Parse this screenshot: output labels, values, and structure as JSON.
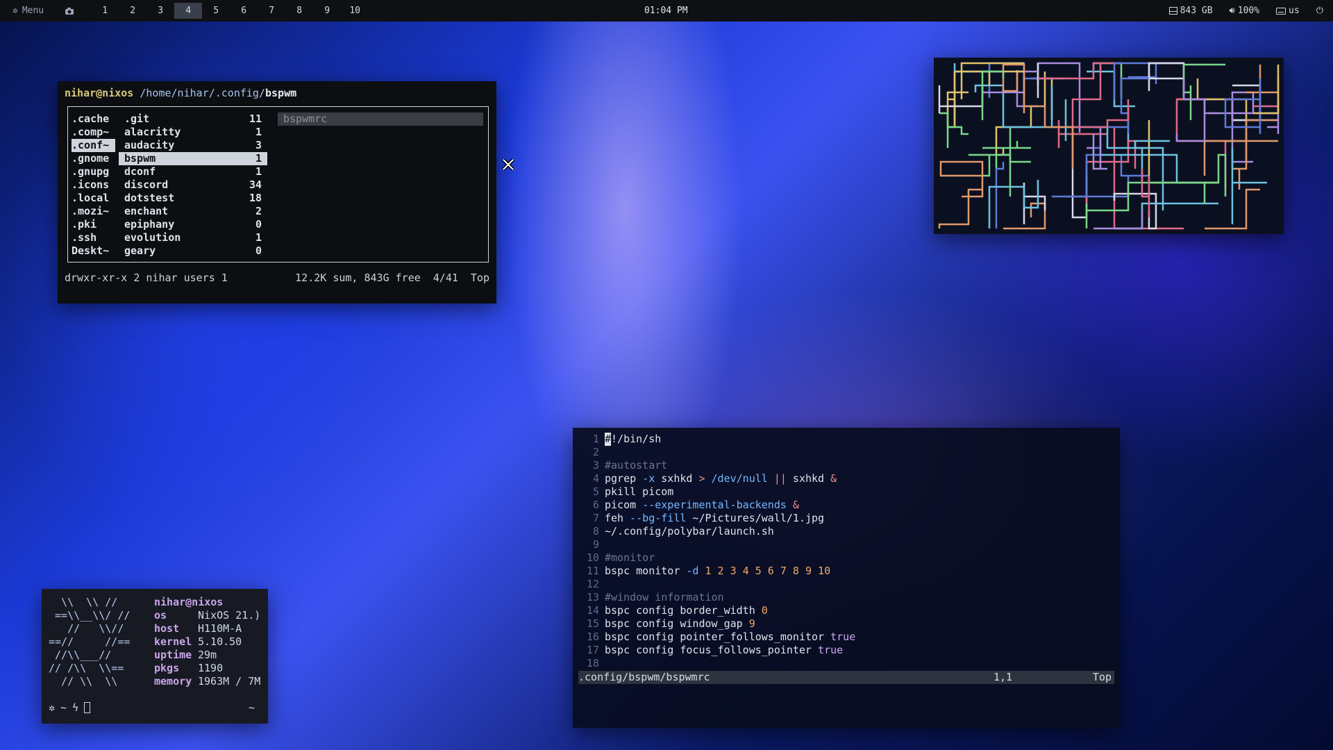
{
  "topbar": {
    "menu_label": "Menu",
    "workspaces": [
      "1",
      "2",
      "3",
      "4",
      "5",
      "6",
      "7",
      "8",
      "9",
      "10"
    ],
    "active_workspace": "4",
    "clock": "01:04 PM",
    "disk": "843 GB",
    "volume": "100%",
    "keyboard": "us"
  },
  "ranger": {
    "user": "nihar@nixos",
    "path": "/home/nihar/.config/",
    "dir": "bspwm",
    "parent_items": [
      ".cache",
      ".comp~",
      ".conf~",
      ".gnome",
      ".gnupg",
      ".icons",
      ".local",
      ".mozi~",
      ".pki",
      ".ssh",
      "Deskt~"
    ],
    "parent_selected": 2,
    "items": [
      {
        "name": ".git",
        "count": "11"
      },
      {
        "name": "alacritty",
        "count": "1"
      },
      {
        "name": "audacity",
        "count": "3"
      },
      {
        "name": "bspwm",
        "count": "1"
      },
      {
        "name": "dconf",
        "count": "1"
      },
      {
        "name": "discord",
        "count": "34"
      },
      {
        "name": "dotstest",
        "count": "18"
      },
      {
        "name": "enchant",
        "count": "2"
      },
      {
        "name": "epiphany",
        "count": "0"
      },
      {
        "name": "evolution",
        "count": "1"
      },
      {
        "name": "geary",
        "count": "0"
      }
    ],
    "selected": 3,
    "preview": "bspwmrc",
    "status_left": "drwxr-xr-x 2 nihar users 1",
    "status_sum": "12.2K sum, 843G free",
    "status_pos": "4/41",
    "status_top": "Top"
  },
  "fetch": {
    "logo": "  \\\\  \\\\ //\n ==\\\\__\\\\/ //\n   //   \\\\//\n==//     //==\n //\\\\___//\n// /\\\\  \\\\==\n  // \\\\  \\\\",
    "user": "nihar@nixos",
    "rows": [
      {
        "k": "os",
        "v": "NixOS 21.)"
      },
      {
        "k": "host",
        "v": "H110M-A"
      },
      {
        "k": "kernel",
        "v": "5.10.50"
      },
      {
        "k": "uptime",
        "v": "29m"
      },
      {
        "k": "pkgs",
        "v": "1190"
      },
      {
        "k": "memory",
        "v": "1963M / 7M"
      }
    ],
    "prompt_tilde": "~",
    "prompt_right": "~"
  },
  "vim": {
    "lines": [
      [
        {
          "t": "#",
          "c": "cur"
        },
        {
          "t": "!/bin/sh"
        }
      ],
      [],
      [
        {
          "t": "#autostart",
          "c": "cm"
        }
      ],
      [
        {
          "t": "pgrep "
        },
        {
          "t": "-x",
          "c": "fl"
        },
        {
          "t": " sxhkd "
        },
        {
          "t": ">",
          "c": "op"
        },
        {
          "t": " /dev/null ",
          "c": "fl"
        },
        {
          "t": "||",
          "c": "op"
        },
        {
          "t": " sxhkd "
        },
        {
          "t": "&",
          "c": "op"
        }
      ],
      [
        {
          "t": "pkill picom"
        }
      ],
      [
        {
          "t": "picom "
        },
        {
          "t": "--experimental-backends",
          "c": "fl"
        },
        {
          "t": " &",
          "c": "op"
        }
      ],
      [
        {
          "t": "feh "
        },
        {
          "t": "--bg-fill",
          "c": "fl"
        },
        {
          "t": " ~/Pictures/wall/1.jpg"
        }
      ],
      [
        {
          "t": "~/.config/polybar/launch.sh"
        }
      ],
      [],
      [
        {
          "t": "#monitor",
          "c": "cm"
        }
      ],
      [
        {
          "t": "bspc monitor "
        },
        {
          "t": "-d",
          "c": "fl"
        },
        {
          "t": " 1 2 3 4 5 6 7 8 9 10",
          "c": "nm"
        }
      ],
      [],
      [
        {
          "t": "#window information",
          "c": "cm"
        }
      ],
      [
        {
          "t": "bspc config border_width "
        },
        {
          "t": "0",
          "c": "nm"
        }
      ],
      [
        {
          "t": "bspc config window_gap "
        },
        {
          "t": "9",
          "c": "nm"
        }
      ],
      [
        {
          "t": "bspc config pointer_follows_monitor "
        },
        {
          "t": "true",
          "c": "kw"
        }
      ],
      [
        {
          "t": "bspc config focus_follows_pointer "
        },
        {
          "t": "true",
          "c": "kw"
        }
      ],
      []
    ],
    "status_path": ".config/bspwm/bspwmrc",
    "status_pos": "1,1",
    "status_top": "Top"
  },
  "colors": {
    "topbar_bg": "#0e1014",
    "ranger_user": "#d9c97e",
    "fetch_key": "#c9a6ea"
  },
  "icons": {
    "menu": "gear-icon",
    "screenshot": "camera-icon",
    "disk": "disk-icon",
    "volume": "speaker-icon",
    "keyboard": "keyboard-icon",
    "power": "power-icon"
  }
}
